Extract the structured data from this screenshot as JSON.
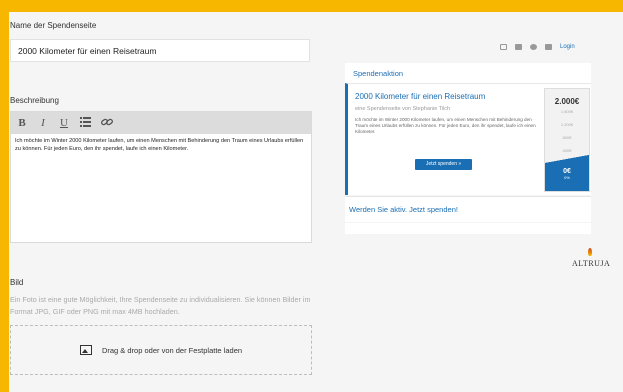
{
  "form": {
    "name_label": "Name der Spendenseite",
    "name_value": "2000 Kilometer für einen Reisetraum",
    "description_label": "Beschreibung",
    "toolbar": {
      "bold": "B",
      "italic": "I",
      "underline": "U",
      "list_icon": "list-icon",
      "link_icon": "link-icon"
    },
    "description_text": "Ich möchte im Winter 2000 Kilometer laufen, um einen Menschen mit Behinderung den Traum eines Urlaubs erfüllen zu können. Für jeden Euro, den ihr spendet, laufe ich einen Kilometer.",
    "image_label": "Bild",
    "image_help": "Ein Foto ist eine gute Möglichkeit, Ihre Spendenseite zu individualisieren. Sie können Bilder im Format JPG, GIF oder PNG mit max 4MB hochladen.",
    "dropzone_label": "Drag & drop oder von der Festplatte laden"
  },
  "preview": {
    "social": {
      "login": "Login"
    },
    "header": "Spendenaktion",
    "campaign": {
      "title": "2000 Kilometer für einen Reisetraum",
      "subtitle": "eine Spendenseite von Stephanie Tilch",
      "text": "Ich möchte im Winter 2000 Kilometer laufen, um einen Menschen mit Behinderung den Traum eines Urlaubs erfüllen zu können. Für jeden Euro, den ihr spendet, laufe ich einen Kilometer.",
      "donate_button": "Jetzt spenden »",
      "goal": "2.000€",
      "ticks": [
        "1.600€",
        "1.200€",
        "800€",
        "400€"
      ],
      "raised": "0€",
      "percent": "0%"
    },
    "cta": "Werden Sie aktiv. Jetzt spenden!",
    "logo": "ALTRUJA"
  }
}
